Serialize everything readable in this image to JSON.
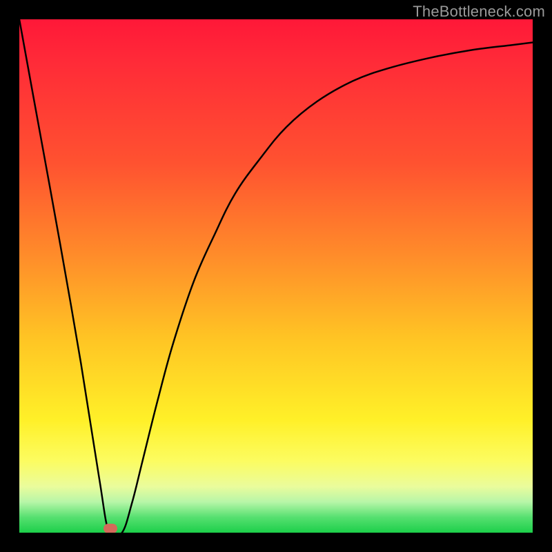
{
  "watermark": "TheBottleneck.com",
  "marker": {
    "color": "#d46a5a",
    "x_frac": 0.178,
    "y_frac": 0.992
  },
  "chart_data": {
    "type": "line",
    "title": "",
    "xlabel": "",
    "ylabel": "",
    "xlim": [
      0,
      1
    ],
    "ylim": [
      0,
      1
    ],
    "grid": false,
    "legend": false,
    "series": [
      {
        "name": "bottleneck-curve",
        "x": [
          0.0,
          0.04,
          0.08,
          0.12,
          0.155,
          0.175,
          0.2,
          0.22,
          0.24,
          0.27,
          0.3,
          0.34,
          0.38,
          0.42,
          0.47,
          0.52,
          0.58,
          0.65,
          0.72,
          0.8,
          0.88,
          0.96,
          1.0
        ],
        "y": [
          1.0,
          0.78,
          0.56,
          0.33,
          0.11,
          0.0,
          0.0,
          0.06,
          0.14,
          0.26,
          0.37,
          0.49,
          0.58,
          0.66,
          0.73,
          0.79,
          0.84,
          0.88,
          0.905,
          0.925,
          0.94,
          0.95,
          0.955
        ]
      }
    ],
    "annotations": [
      {
        "name": "minimum-marker",
        "x": 0.178,
        "y": 0.0,
        "color": "#d46a5a"
      }
    ],
    "background_gradient": {
      "stops": [
        {
          "pos": 0.0,
          "color": "#ff1838"
        },
        {
          "pos": 0.28,
          "color": "#ff5230"
        },
        {
          "pos": 0.46,
          "color": "#ff8c2a"
        },
        {
          "pos": 0.62,
          "color": "#ffc424"
        },
        {
          "pos": 0.78,
          "color": "#fff028"
        },
        {
          "pos": 0.91,
          "color": "#eafc9c"
        },
        {
          "pos": 1.0,
          "color": "#1ccf4a"
        }
      ]
    }
  }
}
